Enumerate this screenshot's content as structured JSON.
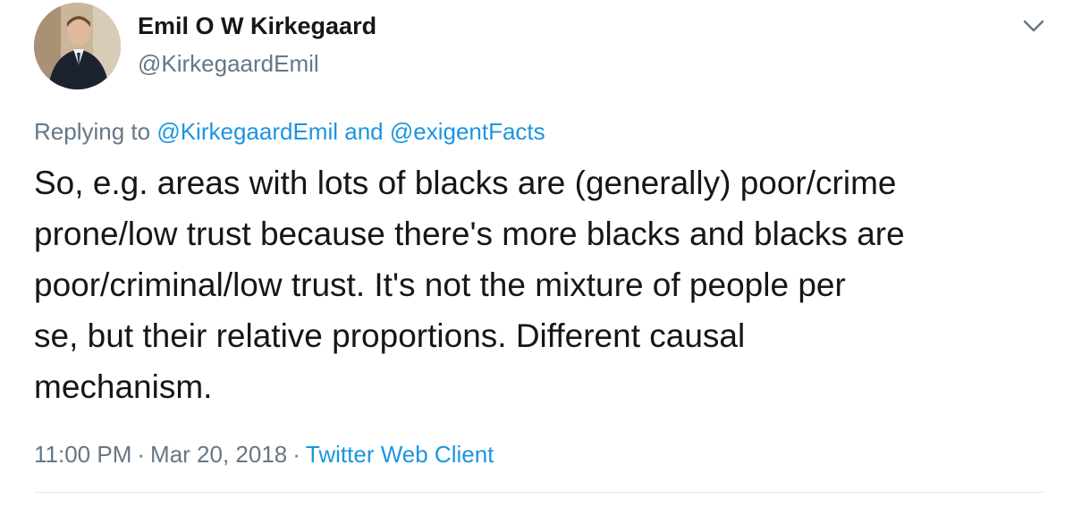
{
  "user": {
    "display_name": "Emil O W Kirkegaard",
    "handle": "@KirkegaardEmil"
  },
  "reply": {
    "prefix": "Replying to",
    "mentions": [
      "@KirkegaardEmil",
      "@exigentFacts"
    ],
    "joiner": "and"
  },
  "tweet": {
    "lines": [
      "So, e.g. areas with lots of blacks are (generally) poor/crime",
      "prone/low trust because there's more blacks and blacks are",
      "poor/criminal/low trust. It's not the mixture of people per",
      "se, but their relative proportions. Different causal",
      "mechanism."
    ]
  },
  "meta": {
    "time": "11:00 PM",
    "separator": "·",
    "date": "Mar 20, 2018",
    "source": "Twitter Web Client"
  },
  "icons": {
    "avatar": "profile-photo",
    "menu": "chevron-down-icon"
  },
  "colors": {
    "text": "#14171a",
    "secondary": "#657786",
    "link": "#1b95e0",
    "divider": "#e1e8ed"
  }
}
